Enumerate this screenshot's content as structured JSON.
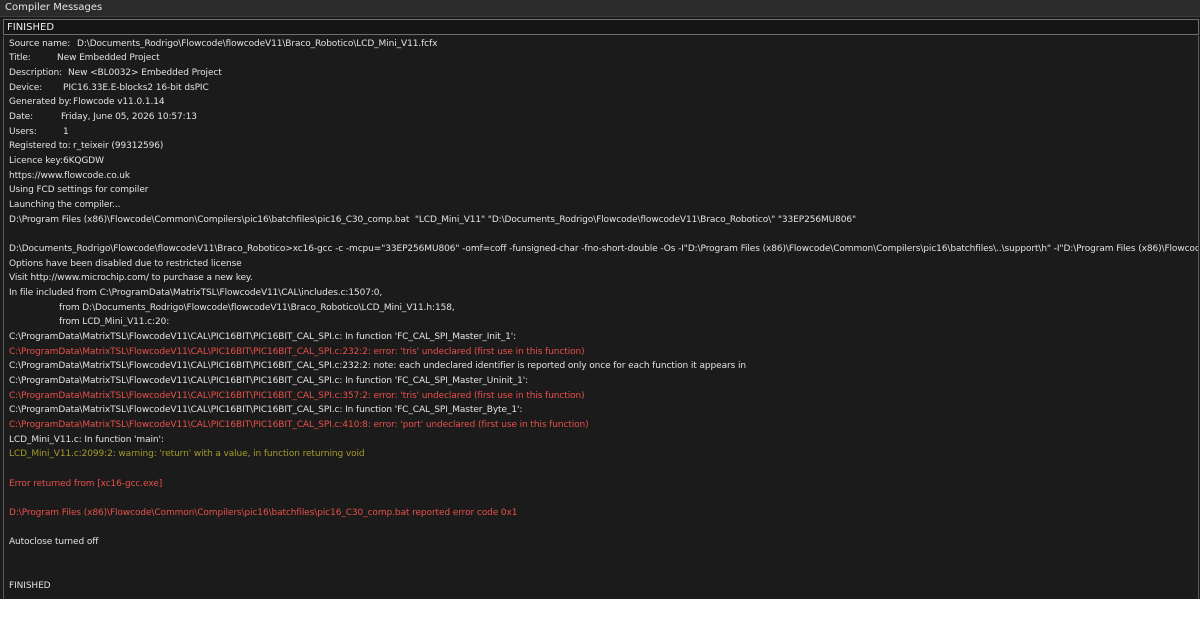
{
  "window": {
    "title": "Compiler Messages"
  },
  "header": {
    "status": "FINISHED"
  },
  "log": {
    "source_label": "Source name:",
    "source_value": "D:\\Documents_Rodrigo\\Flowcode\\flowcodeV11\\Braco_Robotico\\LCD_Mini_V11.fcfx",
    "title_label": "Title:",
    "title_value": "New Embedded Project",
    "description_label": "Description:",
    "description_value": "New <BL0032> Embedded Project",
    "device_label": "Device:",
    "device_value": "PIC16.33E.E-blocks2 16-bit dsPIC",
    "generated_label": "Generated by:",
    "generated_value": "Flowcode v11.0.1.14",
    "date_label": "Date:",
    "date_value": "Friday, June 05, 2026 10:57:13",
    "users_label": "Users:",
    "users_value": "1",
    "registered_label": "Registered to:",
    "registered_value": "r_teixeir (99312596)",
    "licence_label": "Licence key:",
    "licence_value": "6KQGDW",
    "website": "https://www.flowcode.co.uk",
    "fcd_settings": "Using FCD settings for compiler",
    "launching": "Launching the compiler...",
    "batch_cmd": "D:\\Program Files (x86)\\Flowcode\\Common\\Compilers\\pic16\\batchfiles\\pic16_C30_comp.bat  \"LCD_Mini_V11\" \"D:\\Documents_Rodrigo\\Flowcode\\flowcodeV11\\Braco_Robotico\\\" \"33EP256MU806\"",
    "xc16_cmd": "D:\\Documents_Rodrigo\\Flowcode\\flowcodeV11\\Braco_Robotico>xc16-gcc -c -mcpu=\"33EP256MU806\" -omf=coff -funsigned-char -fno-short-double -Os -I\"D:\\Program Files (x86)\\Flowcode\\Common\\Compilers\\pic16\\batchfiles\\..\\support\\h\" -I\"D:\\Program Files (x86)\\Flowcode\\Com",
    "options_disabled": "Options have been disabled due to restricted license",
    "visit": "Visit http://www.microchip.com/ to purchase a new key.",
    "included_from_1": "In file included from C:\\ProgramData\\MatrixTSL\\FlowcodeV11\\CAL\\includes.c:1507:0,",
    "included_from_2": "from D:\\Documents_Rodrigo\\Flowcode\\flowcodeV11\\Braco_Robotico\\LCD_Mini_V11.h:158,",
    "included_from_3": "from LCD_Mini_V11.c:20:",
    "func_init": "C:\\ProgramData\\MatrixTSL\\FlowcodeV11\\CAL\\PIC16BIT\\PIC16BIT_CAL_SPI.c: In function 'FC_CAL_SPI_Master_Init_1':",
    "err_tris_1": "C:\\ProgramData\\MatrixTSL\\FlowcodeV11\\CAL\\PIC16BIT\\PIC16BIT_CAL_SPI.c:232:2: error: 'tris' undeclared (first use in this function)",
    "note_undeclared": "C:\\ProgramData\\MatrixTSL\\FlowcodeV11\\CAL\\PIC16BIT\\PIC16BIT_CAL_SPI.c:232:2: note: each undeclared identifier is reported only once for each function it appears in",
    "func_uninit": "C:\\ProgramData\\MatrixTSL\\FlowcodeV11\\CAL\\PIC16BIT\\PIC16BIT_CAL_SPI.c: In function 'FC_CAL_SPI_Master_Uninit_1':",
    "err_tris_2": "C:\\ProgramData\\MatrixTSL\\FlowcodeV11\\CAL\\PIC16BIT\\PIC16BIT_CAL_SPI.c:357:2: error: 'tris' undeclared (first use in this function)",
    "func_byte": "C:\\ProgramData\\MatrixTSL\\FlowcodeV11\\CAL\\PIC16BIT\\PIC16BIT_CAL_SPI.c: In function 'FC_CAL_SPI_Master_Byte_1':",
    "err_port": "C:\\ProgramData\\MatrixTSL\\FlowcodeV11\\CAL\\PIC16BIT\\PIC16BIT_CAL_SPI.c:410:8: error: 'port' undeclared (first use in this function)",
    "func_main": "LCD_Mini_V11.c: In function 'main':",
    "warn_return": "LCD_Mini_V11.c:2099:2: warning: 'return' with a value, in function returning void",
    "error_returned": "Error returned from [xc16-gcc.exe]",
    "error_code": "D:\\Program Files (x86)\\Flowcode\\Common\\Compilers\\pic16\\batchfiles\\pic16_C30_comp.bat reported error code 0x1",
    "autoclose": "Autoclose turned off",
    "finished": "FINISHED"
  },
  "colors": {
    "background": "#1b1b1b",
    "text": "#e2e2e2",
    "error": "#e8504a",
    "warning": "#a59a2a"
  }
}
